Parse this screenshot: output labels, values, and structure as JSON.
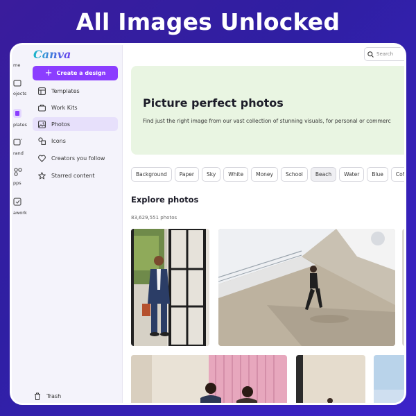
{
  "banner": {
    "title": "All Images Unlocked"
  },
  "rail": {
    "items": [
      {
        "label": "me"
      },
      {
        "label": "ojects"
      },
      {
        "label": "plates"
      },
      {
        "label": "rand"
      },
      {
        "label": "pps"
      },
      {
        "label": "awork"
      }
    ]
  },
  "sidebar": {
    "logo": "Canva",
    "create_label": "Create a design",
    "items": [
      {
        "label": "Templates",
        "icon": "template-icon"
      },
      {
        "label": "Work Kits",
        "icon": "briefcase-icon"
      },
      {
        "label": "Photos",
        "icon": "photo-icon",
        "active": true
      },
      {
        "label": "Icons",
        "icon": "shapes-icon"
      },
      {
        "label": "Creators you follow",
        "icon": "heart-icon"
      },
      {
        "label": "Starred content",
        "icon": "star-icon"
      }
    ],
    "trash_label": "Trash"
  },
  "search": {
    "placeholder": "Search"
  },
  "hero": {
    "title": "Picture perfect photos",
    "subtitle": "Find just the right image from our vast collection of stunning visuals, for personal or commerc"
  },
  "chips": [
    "Background",
    "Paper",
    "Sky",
    "White",
    "Money",
    "School",
    "Beach",
    "Water",
    "Blue",
    "Coffee"
  ],
  "active_chip": "Beach",
  "explore": {
    "title": "Explore photos",
    "count": "83,629,551 photos"
  },
  "colors": {
    "accent": "#8b3dff",
    "hero_bg": "#e9f5e2",
    "frame": "#3a1c9c"
  }
}
